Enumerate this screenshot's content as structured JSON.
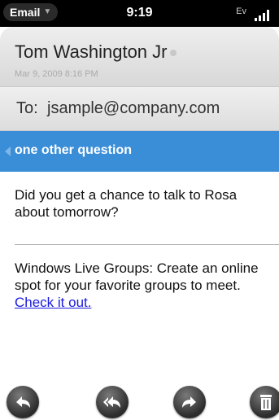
{
  "status_bar": {
    "app_name": "Email",
    "time": "9:19",
    "network": "Ev"
  },
  "header": {
    "sender": "Tom Washington Jr",
    "date": "Mar 9, 2009 8:16 PM"
  },
  "recipient": {
    "label": "To:",
    "value": "jsample@company.com"
  },
  "subject": "one other question",
  "body": {
    "message": "Did you get a chance to talk to Rosa about tomorrow?",
    "footer_text": "Windows Live Groups: Create an online spot for your favorite groups to meet.",
    "footer_link": "Check it out."
  },
  "toolbar": {
    "icons": [
      "reply-icon",
      "reply-all-icon",
      "forward-icon",
      "delete-icon"
    ]
  }
}
